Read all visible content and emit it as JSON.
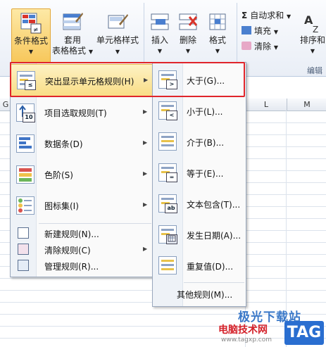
{
  "ribbon": {
    "cond_format": "条件格式",
    "table_format_line1": "套用",
    "table_format_line2": "表格格式",
    "cell_styles": "单元格样式",
    "insert": "插入",
    "delete": "删除",
    "format": "格式",
    "autosum": "自动求和",
    "fill": "填充",
    "clear": "清除",
    "sort": "排序和",
    "edit_group": "编辑"
  },
  "columns": [
    "G",
    "L",
    "M"
  ],
  "menu1": {
    "items": [
      {
        "label": "突出显示单元格规则(H)",
        "has_sub": true
      },
      {
        "label": "项目选取规则(T)",
        "has_sub": true
      },
      {
        "label": "数据条(D)",
        "has_sub": true
      },
      {
        "label": "色阶(S)",
        "has_sub": true
      },
      {
        "label": "图标集(I)",
        "has_sub": true
      },
      {
        "label": "新建规则(N)...",
        "has_sub": false
      },
      {
        "label": "清除规则(C)",
        "has_sub": true
      },
      {
        "label": "管理规则(R)...",
        "has_sub": false
      }
    ],
    "badge_top10": "10"
  },
  "menu2": {
    "items": [
      {
        "label": "大于(G)..."
      },
      {
        "label": "小于(L)..."
      },
      {
        "label": "介于(B)..."
      },
      {
        "label": "等于(E)..."
      },
      {
        "label": "文本包含(T)..."
      },
      {
        "label": "发生日期(A)..."
      },
      {
        "label": "重复值(D)..."
      },
      {
        "label": "其他规则(M)..."
      }
    ],
    "badges": [
      ">",
      "<",
      "",
      "=",
      "ab",
      "",
      "",
      ""
    ]
  },
  "watermark": {
    "line1": "极光下载站",
    "line2": "电脑技术网",
    "url": "www.tagxp.com",
    "tag": "TAG"
  },
  "colors": {
    "highlight": "#f9dd86",
    "annotation": "#e0252b",
    "accent": "#2a6ed0"
  }
}
